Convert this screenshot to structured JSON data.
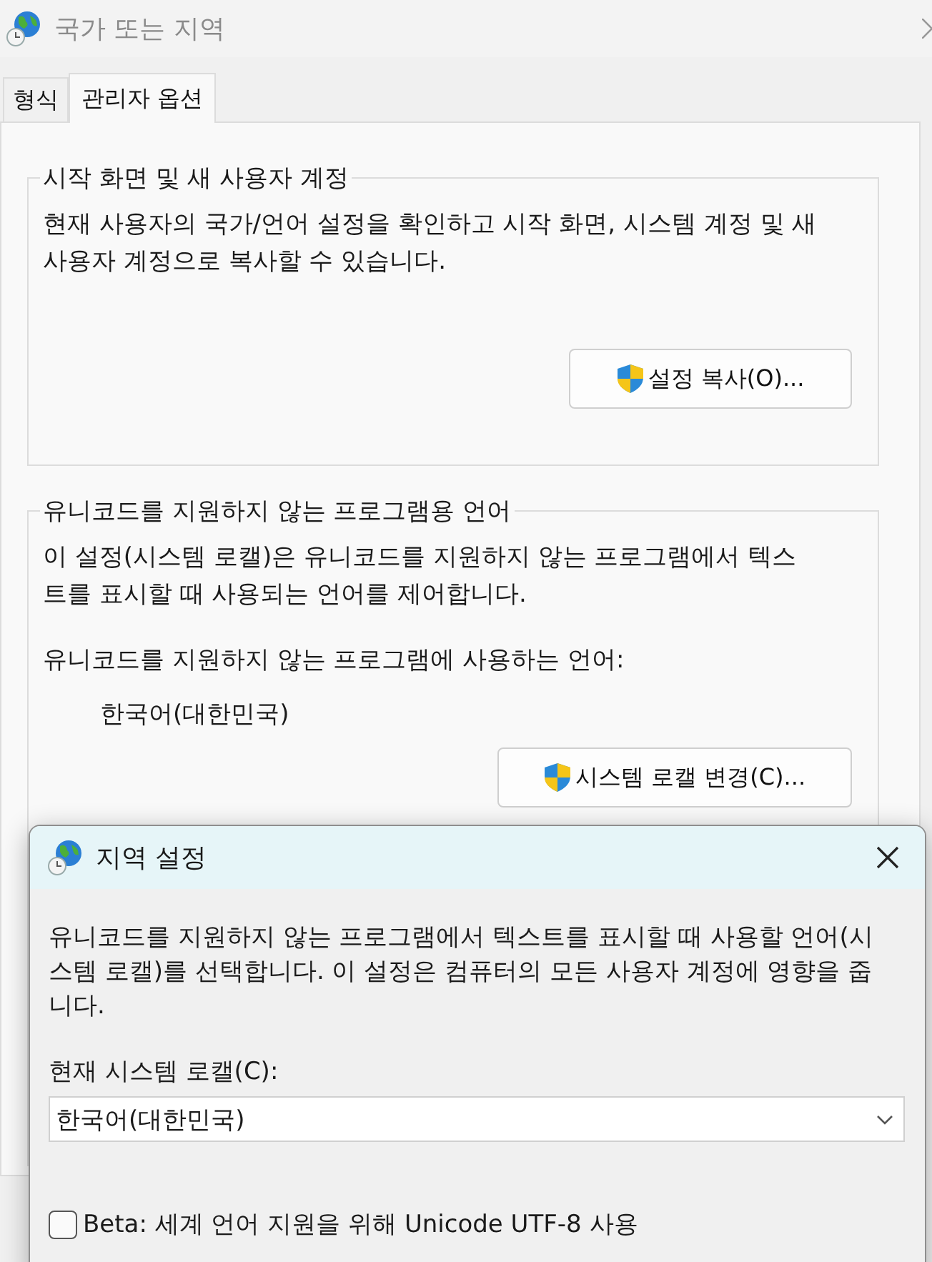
{
  "window": {
    "title": "국가 또는 지역"
  },
  "tabs": [
    {
      "label": "형식",
      "selected": false
    },
    {
      "label": "관리자 옵션",
      "selected": true
    }
  ],
  "groups": [
    {
      "title": "시작 화면 및 새 사용자 계정",
      "paragraphs": [
        "현재 사용자의 국가/언어 설정을 확인하고 시작 화면, 시스템 계정 및 새 사용자 계정으로 복사할 수 있습니다."
      ],
      "button": "설정 복사(O)..."
    },
    {
      "title": "유니코드를 지원하지 않는 프로그램용 언어",
      "paragraphs": [
        "이 설정(시스템 로캘)은 유니코드를 지원하지 않는 프로그램에서 텍스트를 표시할 때 사용되는 언어를 제어합니다.",
        "유니코드를 지원하지 않는 프로그램에 사용하는 언어:"
      ],
      "value": "한국어(대한민국)",
      "button": "시스템 로캘 변경(C)..."
    }
  ],
  "dialog": {
    "title": "지역 설정",
    "description": "유니코드를 지원하지 않는 프로그램에서 텍스트를 표시할 때 사용할 언어(시스템 로캘)를 선택합니다. 이 설정은 컴퓨터의 모든 사용자 계정에 영향을 줍니다.",
    "field_label": "현재 시스템 로캘(C):",
    "locale_select": {
      "value": "한국어(대한민국)"
    },
    "beta_checkbox": {
      "label": "Beta: 세계 언어 지원을 위해 Unicode UTF-8 사용",
      "checked": false
    }
  }
}
